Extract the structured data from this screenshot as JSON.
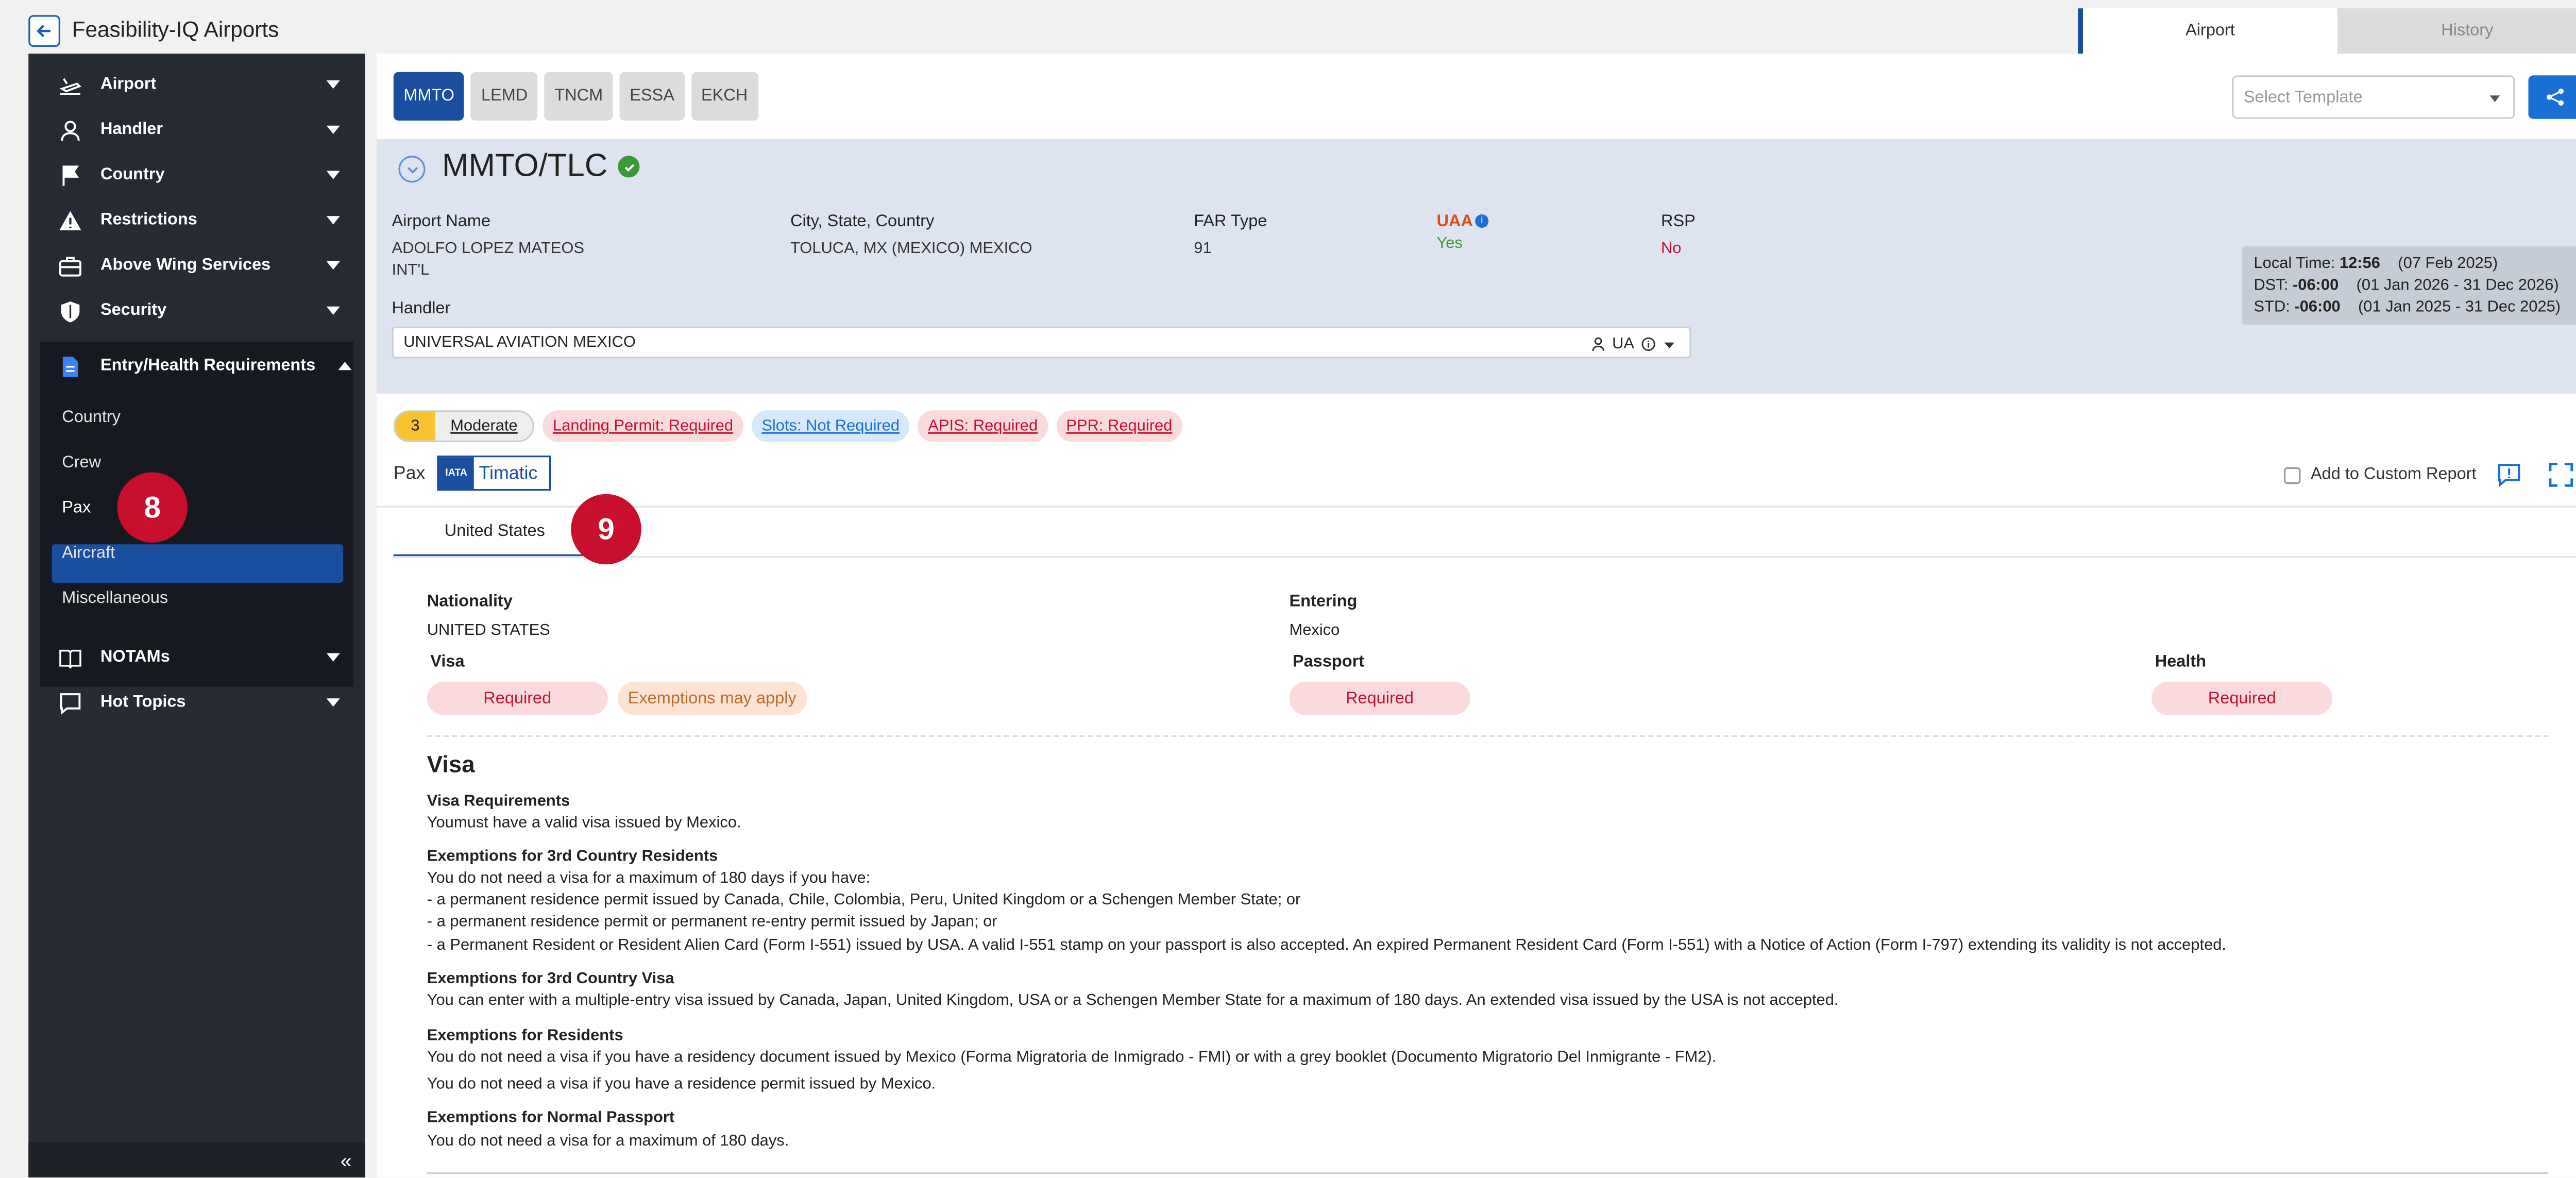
{
  "app": {
    "title": "Feasibility-IQ Airports"
  },
  "top_tabs": [
    {
      "label": "Airport"
    },
    {
      "label": "History"
    }
  ],
  "sidebar": {
    "items": [
      {
        "label": "Airport",
        "icon": "airport-icon"
      },
      {
        "label": "Handler",
        "icon": "user-icon"
      },
      {
        "label": "Country",
        "icon": "flag-icon"
      },
      {
        "label": "Restrictions",
        "icon": "warning-icon"
      },
      {
        "label": "Above Wing Services",
        "icon": "briefcase-icon"
      },
      {
        "label": "Security",
        "icon": "shield-icon"
      },
      {
        "label": "Entry/Health Requirements",
        "icon": "document-icon"
      },
      {
        "label": "NOTAMs",
        "icon": "book-icon"
      },
      {
        "label": "Hot Topics",
        "icon": "chat-icon"
      }
    ],
    "sub_items": [
      {
        "label": "Country"
      },
      {
        "label": "Crew"
      },
      {
        "label": "Pax"
      },
      {
        "label": "Aircraft"
      },
      {
        "label": "Miscellaneous"
      }
    ],
    "collapse_label": "«"
  },
  "badges": {
    "pax": "8",
    "tab": "9"
  },
  "airport_tabs": [
    {
      "label": "MMTO"
    },
    {
      "label": "LEMD"
    },
    {
      "label": "TNCM"
    },
    {
      "label": "ESSA"
    },
    {
      "label": "EKCH"
    }
  ],
  "template": {
    "placeholder": "Select Template"
  },
  "airport": {
    "code": "MMTO/TLC",
    "labels": {
      "name": "Airport Name",
      "city": "City, State, Country",
      "far": "FAR Type",
      "uaa": "UAA",
      "rsp": "RSP",
      "handler": "Handler"
    },
    "name_line1": "ADOLFO LOPEZ MATEOS",
    "name_line2": "INT'L",
    "city": "TOLUCA, MX (MEXICO) MEXICO",
    "far": "91",
    "uaa": "Yes",
    "rsp": "No",
    "handler": "UNIVERSAL AVIATION MEXICO",
    "handler_code": "UA"
  },
  "time": {
    "local_label": "Local Time:",
    "local_value": "12:56",
    "local_date": "(07 Feb 2025)",
    "dst_label": "DST:",
    "dst_value": "-06:00",
    "dst_range": "(01 Jan 2026 - 31 Dec 2026)",
    "std_label": "STD:",
    "std_value": "-06:00",
    "std_range": "(01 Jan 2025 - 31 Dec 2025)"
  },
  "risk": {
    "level": "3",
    "label": "Moderate"
  },
  "tags": [
    {
      "label": "Landing Permit: Required",
      "color": "#c8102e"
    },
    {
      "label": "Slots: Not Required",
      "color": "#1a6fd6"
    },
    {
      "label": "APIS: Required",
      "color": "#c8102e"
    },
    {
      "label": "PPR: Required",
      "color": "#c8102e"
    }
  ],
  "pax": {
    "label": "Pax",
    "timatic": "Timatic",
    "iata": "IATA",
    "custom_report": "Add to Custom Report"
  },
  "country_tab": "United States",
  "summary": {
    "nationality_label": "Nationality",
    "nationality": "UNITED STATES",
    "entering_label": "Entering",
    "entering": "Mexico",
    "visa_label": "Visa",
    "visa": "Required",
    "visa_exempt": "Exemptions may apply",
    "passport_label": "Passport",
    "passport": "Required",
    "health_label": "Health",
    "health": "Required"
  },
  "visa_section": {
    "title": "Visa",
    "req_title": "Visa Requirements",
    "req_text": "Youmust have a valid visa issued by Mexico.",
    "ex3_title": "Exemptions for 3rd Country Residents",
    "ex3_l1": "You do not need a visa for a maximum of 180 days if you have:",
    "ex3_l2": "- a permanent residence permit issued by Canada, Chile, Colombia, Peru, United Kingdom or a Schengen Member State; or",
    "ex3_l3": "- a permanent residence permit or permanent re-entry permit issued by Japan; or",
    "ex3_l4": "- a Permanent Resident or Resident Alien Card (Form I-551) issued by USA. A valid I-551 stamp on your passport is also accepted. An expired Permanent Resident Card (Form I-551) with a Notice of Action (Form I-797) extending its validity is not accepted.",
    "ex3v_title": "Exemptions for 3rd Country Visa",
    "ex3v_text": "You can enter with a multiple-entry visa issued by Canada, Japan, United Kingdom, USA or a Schengen Member State for a maximum of 180 days. An extended visa issued by the USA is not accepted.",
    "exr_title": "Exemptions for Residents",
    "exr_l1": "You do not need a visa if you have a residency document issued by Mexico (Forma Migratoria de Inmigrado - FMI) or with a grey booklet (Documento Migratorio Del Inmigrante - FM2).",
    "exr_l2": "You do not need a visa if you have a residence permit issued by Mexico.",
    "exn_title": "Exemptions for Normal Passport",
    "exn_text": "You do not need a visa for a maximum of 180 days."
  },
  "colors": {
    "primary": "#1a4fa0",
    "sidebar": "#262a33",
    "required": "#c8102e",
    "badge": "#c8102e"
  }
}
